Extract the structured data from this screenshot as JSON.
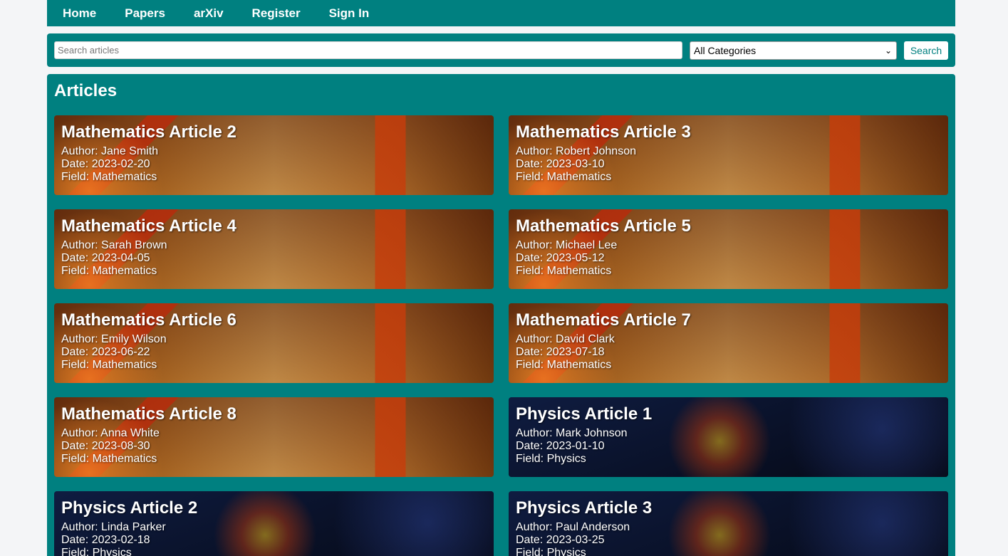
{
  "nav": {
    "items": [
      {
        "label": "Home"
      },
      {
        "label": "Papers"
      },
      {
        "label": "arXiv"
      },
      {
        "label": "Register"
      },
      {
        "label": "Sign In"
      }
    ]
  },
  "search": {
    "placeholder": "Search articles",
    "value": "",
    "category_selected": "All Categories",
    "button_label": "Search"
  },
  "articles": {
    "heading": "Articles",
    "items": [
      {
        "title": "Mathematics Article 2",
        "author": "Author: Jane Smith",
        "date": "Date: 2023-02-20",
        "field": "Field: Mathematics",
        "theme": "math"
      },
      {
        "title": "Mathematics Article 3",
        "author": "Author: Robert Johnson",
        "date": "Date: 2023-03-10",
        "field": "Field: Mathematics",
        "theme": "math"
      },
      {
        "title": "Mathematics Article 4",
        "author": "Author: Sarah Brown",
        "date": "Date: 2023-04-05",
        "field": "Field: Mathematics",
        "theme": "math"
      },
      {
        "title": "Mathematics Article 5",
        "author": "Author: Michael Lee",
        "date": "Date: 2023-05-12",
        "field": "Field: Mathematics",
        "theme": "math"
      },
      {
        "title": "Mathematics Article 6",
        "author": "Author: Emily Wilson",
        "date": "Date: 2023-06-22",
        "field": "Field: Mathematics",
        "theme": "math"
      },
      {
        "title": "Mathematics Article 7",
        "author": "Author: David Clark",
        "date": "Date: 2023-07-18",
        "field": "Field: Mathematics",
        "theme": "math"
      },
      {
        "title": "Mathematics Article 8",
        "author": "Author: Anna White",
        "date": "Date: 2023-08-30",
        "field": "Field: Mathematics",
        "theme": "math"
      },
      {
        "title": "Physics Article 1",
        "author": "Author: Mark Johnson",
        "date": "Date: 2023-01-10",
        "field": "Field: Physics",
        "theme": "phys"
      },
      {
        "title": "Physics Article 2",
        "author": "Author: Linda Parker",
        "date": "Date: 2023-02-18",
        "field": "Field: Physics",
        "theme": "phys"
      },
      {
        "title": "Physics Article 3",
        "author": "Author: Paul Anderson",
        "date": "Date: 2023-03-25",
        "field": "Field: Physics",
        "theme": "phys"
      }
    ]
  },
  "colors": {
    "accent": "#008080",
    "page_bg": "#f4f5f7"
  }
}
